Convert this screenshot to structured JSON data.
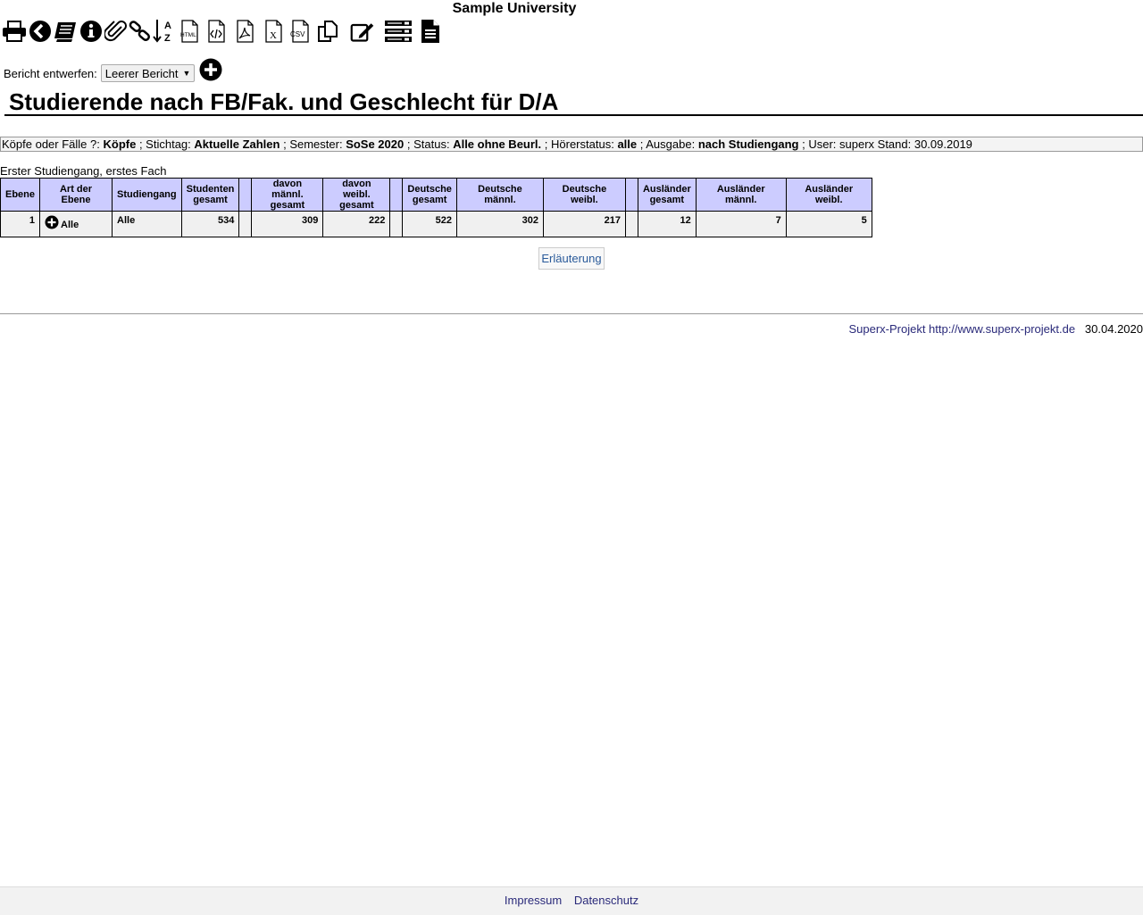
{
  "university": "Sample University",
  "toolbar": [
    {
      "icon": "print-icon"
    },
    {
      "icon": "back-icon"
    },
    {
      "icon": "books-icon"
    },
    {
      "icon": "info-icon"
    },
    {
      "icon": "paperclip-icon"
    },
    {
      "icon": "link-icon"
    },
    {
      "icon": "sort-az-icon",
      "text": "A Z"
    },
    {
      "icon": "html-export-icon",
      "text": "HTML"
    },
    {
      "icon": "xml-export-icon",
      "text": "</>"
    },
    {
      "icon": "pdf-export-icon"
    },
    {
      "icon": "excel-export-icon",
      "text": "X"
    },
    {
      "icon": "csv-export-icon",
      "text": "CSV"
    },
    {
      "icon": "copy-icon"
    },
    {
      "icon": "edit-icon"
    },
    {
      "icon": "table-icon"
    },
    {
      "icon": "document-icon"
    }
  ],
  "report": {
    "label": "Bericht entwerfen:",
    "selected": "Leerer Bericht",
    "add_icon": "plus-circle-icon"
  },
  "title": "Studierende nach FB/Fak. und Geschlecht für D/A",
  "params": [
    {
      "label": "Köpfe oder Fälle ?:",
      "value": "Köpfe"
    },
    {
      "label": "; Stichtag:",
      "value": "Aktuelle Zahlen"
    },
    {
      "label": "; Semester:",
      "value": "SoSe 2020"
    },
    {
      "label": "; Status:",
      "value": "Alle ohne Beurl."
    },
    {
      "label": "; Hörerstatus:",
      "value": "alle"
    },
    {
      "label": "; Ausgabe:",
      "value": "nach Studiengang"
    },
    {
      "label": "; User: superx  Stand: 30.09.2019",
      "value": ""
    }
  ],
  "caption": "Erster Studiengang, erstes Fach",
  "table": {
    "headers": [
      "Ebene",
      "Art der Ebene",
      "Studiengang",
      "Studenten gesamt",
      "",
      "davon männl. gesamt",
      "davon weibl. gesamt",
      "",
      "Deutsche gesamt",
      "Deutsche männl.",
      "Deutsche weibl.",
      "",
      "Ausländer gesamt",
      "Ausländer männl.",
      "Ausländer weibl."
    ],
    "rows": [
      [
        "1",
        "Alle",
        "Alle",
        "534",
        "",
        "309",
        "222",
        "",
        "522",
        "302",
        "217",
        "",
        "12",
        "7",
        "5"
      ]
    ]
  },
  "explanation_button": "Erläuterung",
  "footer": {
    "link": "Superx-Projekt http://www.superx-projekt.de",
    "date": "30.04.2020"
  },
  "bottom_links": [
    "Impressum",
    "Datenschutz"
  ]
}
